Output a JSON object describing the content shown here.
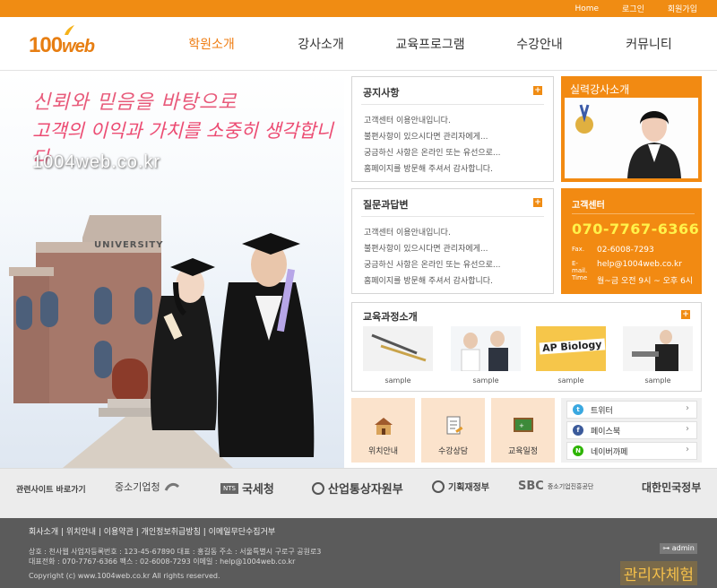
{
  "topbar": {
    "home": "Home",
    "login": "로그인",
    "join": "회원가입"
  },
  "brand": {
    "logo_num": "100",
    "logo_word": "web",
    "accent": "#f08c13"
  },
  "nav": [
    "학원소개",
    "강사소개",
    "교육프로그램",
    "수강안내",
    "커뮤니티"
  ],
  "hero": {
    "slogan1": "신뢰와 믿음을 바탕으로",
    "slogan2": "고객의 이익과 가치를 소중히 생각합니다",
    "domain": "1004web.co.kr",
    "building_sign": "UNIVERSITY"
  },
  "notice": {
    "title": "공지사항",
    "items": [
      "고객센터 이용안내입니다.",
      "불편사항이 있으시다면 관리자에게...",
      "궁금하신 사항은 온라인 또는 유선으로...",
      "홈페이지를 방문해 주셔서 감사합니다."
    ]
  },
  "qna": {
    "title": "질문과답변",
    "items": [
      "고객센터 이용안내입니다.",
      "불편사항이 있으시다면 관리자에게...",
      "궁금하신 사항은 온라인 또는 유선으로...",
      "홈페이지를 방문해 주셔서 감사합니다."
    ]
  },
  "teacher": {
    "title": "실력강사소개"
  },
  "customer": {
    "title": "고객센터",
    "phone": "070-7767-6366",
    "fax_label": "Fax.",
    "fax": "02-6008-7293",
    "email_label": "E-mail.",
    "email": "help@1004web.co.kr",
    "time_label": "Time",
    "time": "월~금 오전 9시 ~ 오후 6시"
  },
  "courses": {
    "title": "교육과정소개",
    "items": [
      {
        "cap": "sample",
        "img_text": ""
      },
      {
        "cap": "sample",
        "img_text": ""
      },
      {
        "cap": "sample",
        "img_text": "AP Biology"
      },
      {
        "cap": "sample",
        "img_text": ""
      }
    ]
  },
  "quick": [
    "위치안내",
    "수강상담",
    "교육일정"
  ],
  "sns": [
    "트위터",
    "페이스북",
    "네이버까페"
  ],
  "related": {
    "label": "관련사이트 바로가기",
    "sites": [
      "중소기업청",
      "국세청",
      "산업통상자원부",
      "기획재정부",
      "중소기업진흥공단",
      "대한민국정부"
    ],
    "nts": "NTS",
    "sbc": "SBC"
  },
  "footer": {
    "links": "회사소개 | 위치안내 | 이용약관 | 개인정보취급방침 | 이메일무단수집거부",
    "info1": "상호 : 천사웹   사업자등록번호 : 123-45-67890   대표 : 홍길동   주소 : 서울특별시 구로구 공원로3",
    "info2": "대표전화 : 070-7767-6366   팩스 : 02-6008-7293   이메일 : help@1004web.co.kr",
    "copy": "Copyright (c) www.1004web.co.kr All rights reserved.",
    "admin": "admin",
    "experience": "관리자체험"
  }
}
